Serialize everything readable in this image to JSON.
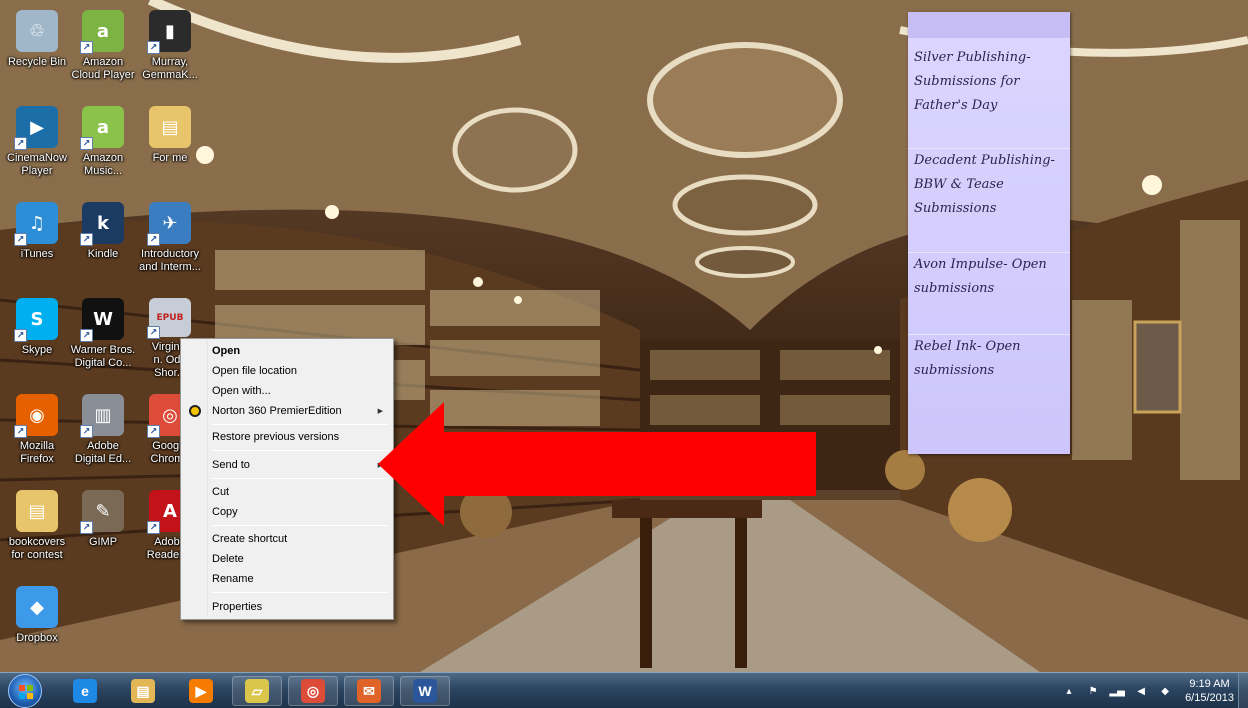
{
  "desktop": {
    "icons": [
      {
        "label": "Recycle Bin",
        "icon": "recycle-bin-icon",
        "color": "#9fb7c9",
        "glyph": "♲",
        "shortcut": false
      },
      {
        "label": "Amazon\nCloud Player",
        "icon": "amazon-cloud-player-icon",
        "color": "#7cb342",
        "glyph": "a",
        "shortcut": true
      },
      {
        "label": "Murray,\nGemmaK...",
        "icon": "book-cover-icon",
        "color": "#2b2b2b",
        "glyph": "▮",
        "shortcut": true
      },
      {
        "label": "CinemaNow\nPlayer",
        "icon": "cinemanow-icon",
        "color": "#1b6ea8",
        "glyph": "▶",
        "shortcut": true
      },
      {
        "label": "Amazon\nMusic...",
        "icon": "amazon-music-icon",
        "color": "#8bc34a",
        "glyph": "a",
        "shortcut": true
      },
      {
        "label": "For me",
        "icon": "folder-icon",
        "color": "#e8c46a",
        "glyph": "▤",
        "shortcut": false
      },
      {
        "label": "iTunes",
        "icon": "itunes-icon",
        "color": "#2c8ed6",
        "glyph": "♫",
        "shortcut": true
      },
      {
        "label": "Kindle",
        "icon": "kindle-icon",
        "color": "#1c3b63",
        "glyph": "k",
        "shortcut": true
      },
      {
        "label": "Introductory\nand Interm...",
        "icon": "document-icon",
        "color": "#3a7dc0",
        "glyph": "✈",
        "shortcut": true
      },
      {
        "label": "Skype",
        "icon": "skype-icon",
        "color": "#00aff0",
        "glyph": "S",
        "shortcut": true
      },
      {
        "label": "Warner Bros.\nDigital Co...",
        "icon": "warner-bros-icon",
        "color": "#111111",
        "glyph": "W",
        "shortcut": true
      },
      {
        "label": "Virginia\nn. Odd\nShor...",
        "icon": "epub-file-icon",
        "color": "#c7cdd6",
        "glyph": "EPUB",
        "shortcut": true
      },
      {
        "label": "Mozilla\nFirefox",
        "icon": "firefox-icon",
        "color": "#e66000",
        "glyph": "◉",
        "shortcut": true
      },
      {
        "label": "Adobe\nDigital Ed...",
        "icon": "adobe-digital-editions-icon",
        "color": "#8a8f97",
        "glyph": "▥",
        "shortcut": true
      },
      {
        "label": "Google\nChrome",
        "icon": "chrome-icon",
        "color": "#dd4b39",
        "glyph": "◎",
        "shortcut": true
      },
      {
        "label": "bookcovers\nfor contest",
        "icon": "folder-icon",
        "color": "#e8c46a",
        "glyph": "▤",
        "shortcut": false
      },
      {
        "label": "GIMP",
        "icon": "gimp-icon",
        "color": "#7a6a55",
        "glyph": "✎",
        "shortcut": true
      },
      {
        "label": "Adobe\nReader X",
        "icon": "adobe-reader-icon",
        "color": "#c4121a",
        "glyph": "A",
        "shortcut": true
      },
      {
        "label": "Dropbox",
        "icon": "dropbox-icon",
        "color": "#3d9ae8",
        "glyph": "◆",
        "shortcut": false
      }
    ]
  },
  "sticky_note": {
    "items": [
      "Silver Publishing-\nSubmissions for\nFather's Day",
      "Decadent Publishing-\nBBW & Tease\nSubmissions",
      "Avon Impulse- Open\nsubmissions",
      "Rebel Ink- Open\nsubmissions"
    ]
  },
  "context_menu": {
    "open": "Open",
    "open_file_location": "Open file location",
    "open_with": "Open with...",
    "norton": "Norton 360 PremierEdition",
    "restore": "Restore previous versions",
    "send_to": "Send to",
    "cut": "Cut",
    "copy": "Copy",
    "create_shortcut": "Create shortcut",
    "delete": "Delete",
    "rename": "Rename",
    "properties": "Properties"
  },
  "annotation": {
    "color": "#ff0000"
  },
  "taskbar": {
    "pinned": [
      {
        "icon": "internet-explorer-icon",
        "color": "#1e88e5",
        "glyph": "e"
      },
      {
        "icon": "file-explorer-icon",
        "color": "#e3b656",
        "glyph": "▤"
      },
      {
        "icon": "media-player-icon",
        "color": "#f57c00",
        "glyph": "▶"
      },
      {
        "icon": "sticky-notes-icon",
        "color": "#d9c64a",
        "glyph": "▱"
      },
      {
        "icon": "chrome-icon",
        "color": "#dd4b39",
        "glyph": "◎"
      },
      {
        "icon": "mail-icon",
        "color": "#e0632a",
        "glyph": "✉"
      },
      {
        "icon": "word-icon",
        "color": "#2b579a",
        "glyph": "W"
      }
    ],
    "clock": {
      "time": "9:19 AM",
      "date": "6/15/2013"
    }
  }
}
